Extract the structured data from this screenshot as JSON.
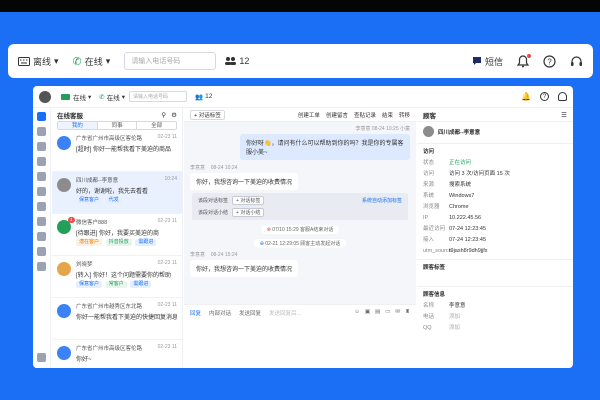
{
  "toolbar": {
    "status_label": "离线",
    "call_status": "在线",
    "search_placeholder": "请输入电话号码",
    "queue_count": "12",
    "message_label": "短信"
  },
  "app_header": {
    "status": "在线",
    "call_status": "在线",
    "search_placeholder": "请输入电话号码",
    "queue_count": "12"
  },
  "list": {
    "title": "在线客服",
    "tabs": [
      "我的",
      "同事",
      "全部"
    ],
    "items": [
      {
        "name": "广东省广州市高级区客伦路",
        "time": "02-23 11",
        "msg": "[超时] 你好一能帮我看下美迫的商品",
        "tags": []
      },
      {
        "name": "四川成都--李意意",
        "time": "10:24",
        "msg": "好的，谢谢啦，我先去看看",
        "tags": [
          "保意客户",
          "代发"
        ]
      },
      {
        "name": "微信客户888",
        "time": "02-23 11",
        "msg": "[待跟进] 你好，我要买美迫的商",
        "tags": [
          "潜在客户",
          "抖音投放",
          "需跟进"
        ],
        "badge": "1"
      },
      {
        "name": "刘晓梦",
        "time": "02-23 11",
        "msg": "[转入] 你好！这个问题需要你的帮助",
        "tags": [
          "保意客户",
          "常客户",
          "需跟进"
        ]
      },
      {
        "name": "广东省广州市越秀区东北路",
        "time": "02-23 11",
        "msg": "你好一能帮我看下美迫的快捷回复消息",
        "tags": []
      },
      {
        "name": "广东省广州市高级区客伦路",
        "time": "02-23 11",
        "msg": "你好~",
        "tags": []
      }
    ]
  },
  "chat": {
    "actions": [
      "创建工单",
      "创建留言",
      "查贴记录",
      "结束",
      "转移"
    ],
    "top_meta": "李意意  08-24 10:25 小童",
    "greeting": "你好呀👋，请问有什么可以帮助到你的吗？我是你的专属客服小美~",
    "customer_name": "李意意",
    "customer_time": "08-24 10:24",
    "customer_msg1": "你好，我想咨询一下美迫的收费情况",
    "tag_label1": "该段对话标签",
    "tag_btn1": "+ 对话标签",
    "tag_label2": "该段对话小结",
    "tag_btn2": "+ 对话小结",
    "tag_link": "系统自动添加标签",
    "sys1": "07/10 15:29  客服A结束对话",
    "sys2": "02-21 12:29:05  顾客主动发起对话",
    "customer_time2": "08-24 15:24",
    "customer_msg2": "你好，我想咨询一下美迫的收费情况",
    "input_tabs": [
      "回复",
      "内部对话",
      "发送回复"
    ],
    "input_hint": "发送回复后..."
  },
  "detail": {
    "title": "顾客",
    "customer": "四川成都--李意意",
    "section1": "访问",
    "rows": [
      {
        "k": "状态",
        "v": "正在访问"
      },
      {
        "k": "访问",
        "v": "访问 3 次/访问页面 15 次"
      },
      {
        "k": "来源",
        "v": "搜索系统"
      },
      {
        "k": "系统",
        "v": "Windows7"
      },
      {
        "k": "浏览器",
        "v": "Chrome"
      },
      {
        "k": "IP",
        "v": "10.222.45.56"
      },
      {
        "k": "最近访问",
        "v": "07-24 12:23:45"
      },
      {
        "k": "接入",
        "v": "07-24 12:23:45"
      },
      {
        "k": "utm_source",
        "v": "t9jash8r9dh9jjfx"
      }
    ],
    "section2": "顾客标签",
    "section3": "顾客信息",
    "info": [
      {
        "k": "名称",
        "v": "李意意"
      },
      {
        "k": "电话",
        "v": "添加"
      },
      {
        "k": "QQ",
        "v": "添加"
      }
    ]
  },
  "colors": {
    "accent": "#1a6ff5",
    "background": "#1a6ff5"
  }
}
